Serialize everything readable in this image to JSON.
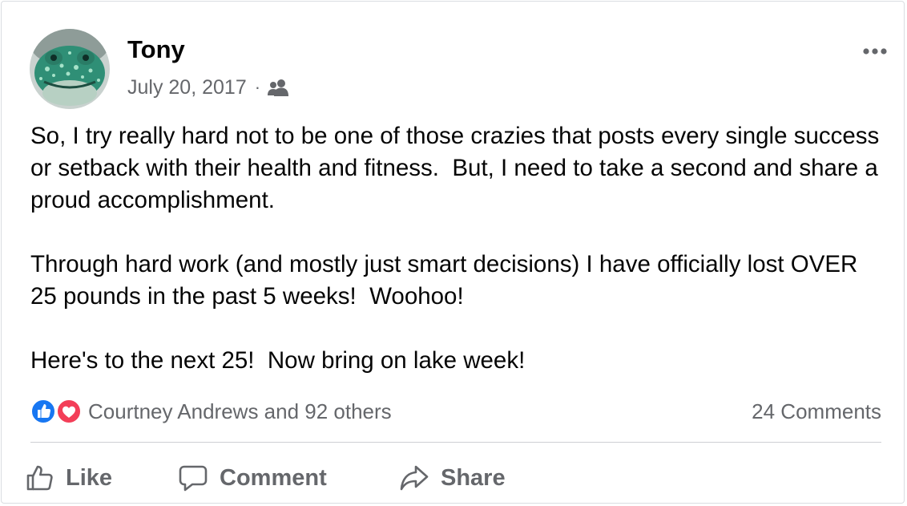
{
  "post": {
    "author": "Tony",
    "date": "July 20, 2017",
    "separator": "·",
    "audience_icon": "friends-icon",
    "menu_icon": "more-options-icon",
    "body": {
      "p1": "So, I try really hard not to be one of those crazies that posts every single success or setback with their health and fitness.  But, I need to take a second and share a proud accomplishment.",
      "p2": "Through hard work (and mostly just smart decisions) I have officially lost OVER 25 pounds in the past 5 weeks!  Woohoo!",
      "p3": "Here's to the next 25!  Now bring on lake week!"
    }
  },
  "reactions": {
    "icons": [
      "like-reaction-icon",
      "love-reaction-icon"
    ],
    "names": "Courtney Andrews and 92 others",
    "comment_count": "24 Comments"
  },
  "actions": {
    "like": "Like",
    "comment": "Comment",
    "share": "Share"
  },
  "colors": {
    "text_primary": "#050505",
    "text_secondary": "#65676b",
    "like_blue": "#1877f2",
    "love_red": "#f33e58",
    "divider": "#ced0d4"
  }
}
